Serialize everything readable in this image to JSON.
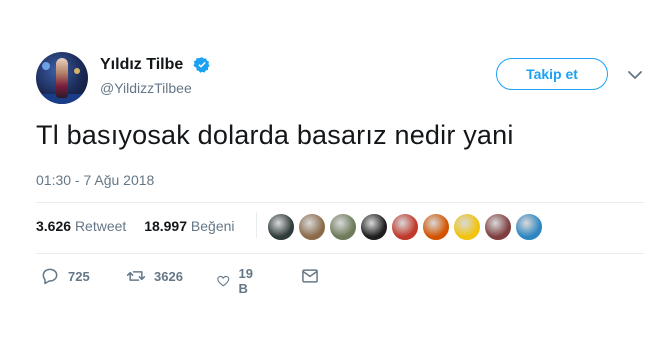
{
  "profile": {
    "display_name": "Yıldız Tilbe",
    "handle": "@YildizzTilbee",
    "verified_icon": "verified-badge-icon",
    "avatar_icon": "profile-avatar"
  },
  "follow_button": {
    "label": "Takip et"
  },
  "menu": {
    "icon": "chevron-down-icon"
  },
  "tweet": {
    "text": "Tl basıyosak dolarda basarız nedir yani",
    "timestamp": "01:30 - 7 Ağu 2018"
  },
  "stats": {
    "retweets_count": "3.626",
    "retweets_label": "Retweet",
    "likes_count": "18.997",
    "likes_label": "Beğeni"
  },
  "likers": [
    {
      "name": "liker-avatar-1",
      "color": "#2f3b3a"
    },
    {
      "name": "liker-avatar-2",
      "color": "#8a6a4a"
    },
    {
      "name": "liker-avatar-3",
      "color": "#6d7b5a"
    },
    {
      "name": "liker-avatar-4",
      "color": "#1e1e1e"
    },
    {
      "name": "liker-avatar-5",
      "color": "#c0392b"
    },
    {
      "name": "liker-avatar-6",
      "color": "#d35400"
    },
    {
      "name": "liker-avatar-7",
      "color": "#f1c40f"
    },
    {
      "name": "liker-avatar-8",
      "color": "#7f3f3f"
    },
    {
      "name": "liker-avatar-9",
      "color": "#2e86c1"
    }
  ],
  "actions": {
    "reply_count": "725",
    "retweet_count": "3626",
    "like_count": "19 B",
    "reply_icon": "reply-icon",
    "retweet_icon": "retweet-icon",
    "like_icon": "heart-icon",
    "dm_icon": "direct-message-icon"
  },
  "colors": {
    "accent": "#1da1f2",
    "secondary_text": "#657786",
    "text": "#14171a"
  }
}
